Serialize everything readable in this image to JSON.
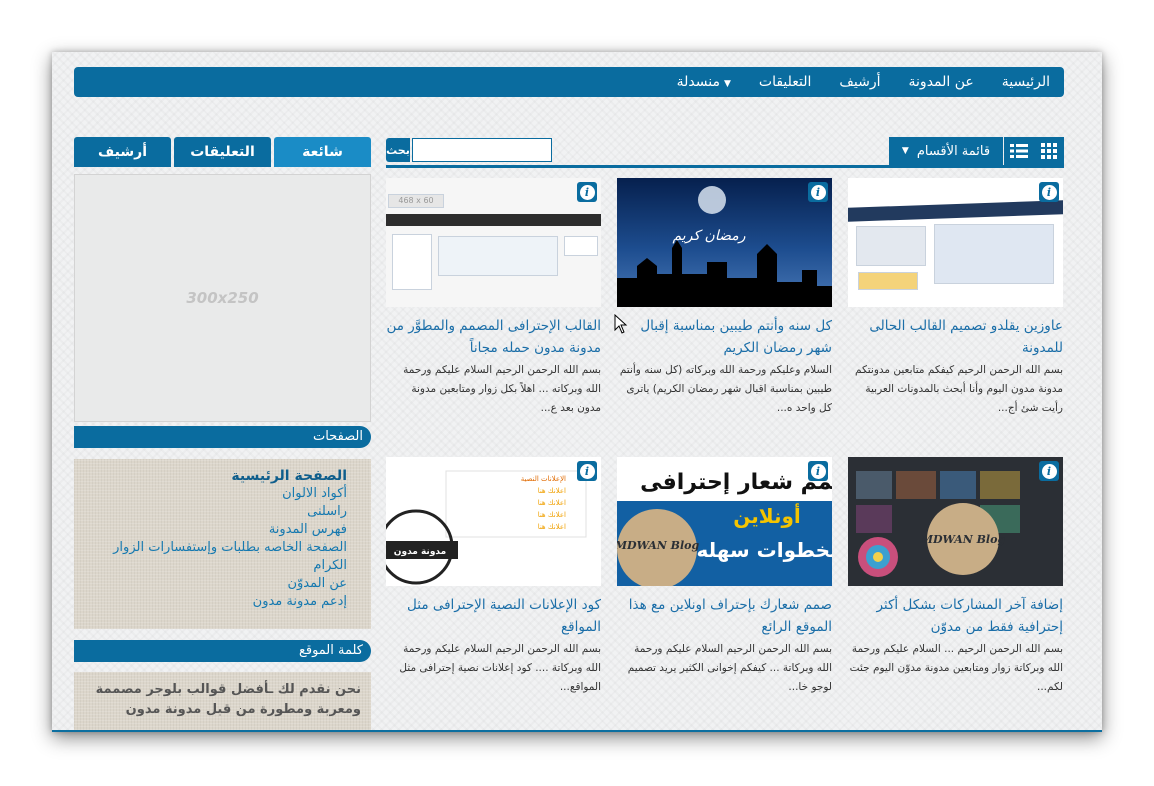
{
  "nav": {
    "items": [
      "الرئيسية",
      "عن المدونة",
      "أرشيف",
      "التعليقات",
      "منسدلة"
    ]
  },
  "sidebar": {
    "tabs": [
      "شائعة",
      "التعليقات",
      "أرشيف"
    ],
    "ad_label": "300x250",
    "pages_title": "الصفحات",
    "pages": [
      "الصفحة الرئيسية",
      "أكواد الالوان",
      "راسلنى",
      "فهرس المدونة",
      "الصفحة الخاصه بطلبات وإستفسارات الزوار الكرام",
      "عن المدوّن",
      "إدعم مدونة مدون"
    ],
    "site_word_title": "كلمة الموقع",
    "site_word_text": "نحن نقدم لك ـأفضل قوالب بلوجر مصممة ومعربة ومطورة من قبل مدونة مدون"
  },
  "toolbar": {
    "search_label": "بحث",
    "search_value": "",
    "categories_label": "قائمة الأقسام"
  },
  "posts": [
    {
      "title": "عاوزين يقلدو تصميم القالب الحالى للمدونة",
      "snippet": "بسم الله الرحمن الرحيم كيفكم متابعين مدونتكم مدونة مدون اليوم وأنا أبحث بالمدونات العربية رأيت شئ أج..."
    },
    {
      "title": "كل سنه وأنتم طيبين بمناسبة إقبال شهر رمضان الكريم",
      "snippet": "السلام وعليكم ورحمة الله وبركاته (كل سنه وأنتم طيبين بمناسبة اقبال شهر رمضان الكريم) ياترى كل واحد ه..."
    },
    {
      "title": "القالب الإحترافى المصمم والمطوَّر من مدونة مدون حمله مجاناً",
      "snippet": "بسم الله الرحمن الرحيم السلام عليكم ورحمة الله وبركاته ... اهلاً بكل زوار ومتابعين مدونة مدون بعد ع..."
    },
    {
      "title": "إضافة آخر المشاركات بشكل أكثر إحترافية فقط من مدوّن",
      "snippet": "بسم الله الرحمن الرحيم ... السلام عليكم ورحمة الله وبركاتة  زوار ومتابعين مدونة مدوّن اليوم جئت لكم..."
    },
    {
      "title": "صمم شعارك بإحتراف اونلاين مع هذا الموقع الرائع",
      "snippet": "بسم الله الرحمن الرحيم  السلام عليكم ورحمة الله وبركاتة ... كيفكم إخوانى الكثير يريد تصميم لوجو خا..."
    },
    {
      "title": "كود الإعلانات النصية الإحترافى مثل المواقع",
      "snippet": "بسم الله الرحمن الرحيم  السلام عليكم ورحمة الله وبركاتة ....  كود إعلانات نصية إحترافى مثل المواقع..."
    }
  ],
  "thumb_text": {
    "ad_size": "468 x 60",
    "ramadan": "رمضان كريم",
    "logo_line1": "صمم شعار إحترافى",
    "logo_line2": "أونلاين",
    "logo_line3": "بخطوات سهله",
    "logo_badge": "MDWAN Blog",
    "recent_badge": "MDWAN Blog",
    "text_ads_header": "الإعلانات النصية",
    "text_ads_item": "اعلانك هنا",
    "stamp": "مدونة مدون"
  },
  "colors": {
    "primary": "#0a6c9f",
    "active_tab": "#1a8cc6",
    "link": "#1b6ea8"
  }
}
